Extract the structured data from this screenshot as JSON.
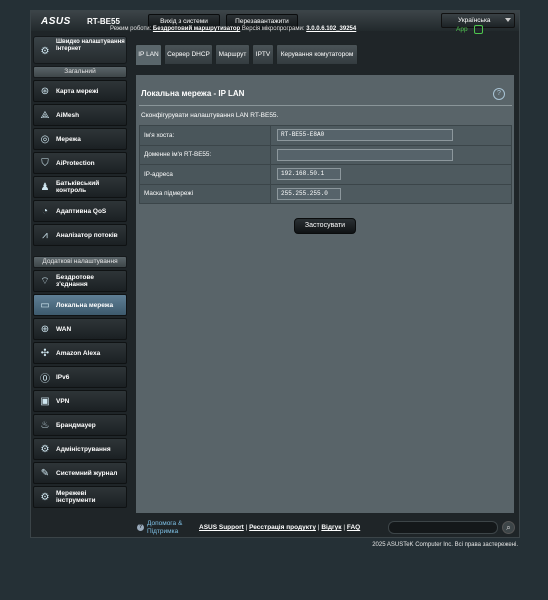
{
  "header": {
    "logo": "ASUS",
    "model": "RT-BE55",
    "logout_label": "Вихід з системи",
    "reboot_label": "Перезавантажити",
    "language": "Українська"
  },
  "status_bar": {
    "mode_label": "Режим роботи:",
    "mode_value": "Бездротовий маршрутизатор",
    "firmware_label": "Версія мікропрограми:",
    "firmware_value": "3.0.0.6.102_39254",
    "app_label": "App"
  },
  "sidebar": {
    "quick_setup": "Швидко налаштування Інтернет",
    "general_header": "Загальний",
    "general_items": [
      {
        "label": "Карта мережі",
        "icon": "network-map-icon"
      },
      {
        "label": "AiMesh",
        "icon": "aimesh-icon"
      },
      {
        "label": "Мережа",
        "icon": "network-icon"
      },
      {
        "label": "AiProtection",
        "icon": "shield-icon"
      },
      {
        "label": "Батьківський контроль",
        "icon": "parental-control-icon"
      },
      {
        "label": "Адаптивна QoS",
        "icon": "speedometer-icon"
      },
      {
        "label": "Аналізатор потоків",
        "icon": "traffic-analyzer-icon"
      }
    ],
    "advanced_header": "Додаткові налаштування",
    "advanced_items": [
      {
        "label": "Бездротове з'єднання",
        "icon": "wireless-icon"
      },
      {
        "label": "Локальна мережа",
        "icon": "lan-icon",
        "active": true
      },
      {
        "label": "WAN",
        "icon": "globe-icon"
      },
      {
        "label": "Amazon Alexa",
        "icon": "alexa-icon"
      },
      {
        "label": "IPv6",
        "icon": "ipv6-icon"
      },
      {
        "label": "VPN",
        "icon": "vpn-icon"
      },
      {
        "label": "Брандмауер",
        "icon": "firewall-icon"
      },
      {
        "label": "Адміністрування",
        "icon": "admin-icon"
      },
      {
        "label": "Системний журнал",
        "icon": "system-log-icon"
      },
      {
        "label": "Мережеві інструменти",
        "icon": "network-tools-icon"
      }
    ]
  },
  "tabs": [
    "IP LAN",
    "Сервер DHCP",
    "Маршрут",
    "IPTV",
    "Керування комутатором"
  ],
  "content": {
    "title": "Локальна мережа - IP LAN",
    "description": "Сконфігурувати налаштування LAN RT-BE55.",
    "help_symbol": "?",
    "fields": [
      {
        "label": "Ім'я хоста:",
        "value": "RT-BE55-E8A0"
      },
      {
        "label": "Доменне ім'я RT-BE55:",
        "value": ""
      },
      {
        "label": "IP-адреса",
        "value": "192.168.50.1"
      },
      {
        "label": "Маска підмережі",
        "value": "255.255.255.0"
      }
    ],
    "apply_label": "Застосувати"
  },
  "footer": {
    "help_label": "Допомога & Підтримка",
    "links": [
      "ASUS Support",
      "Ресстрація продукту",
      "Відгук",
      "FAQ"
    ],
    "copyright": "2025 ASUSTeK Computer Inc. Всі права застережені."
  }
}
